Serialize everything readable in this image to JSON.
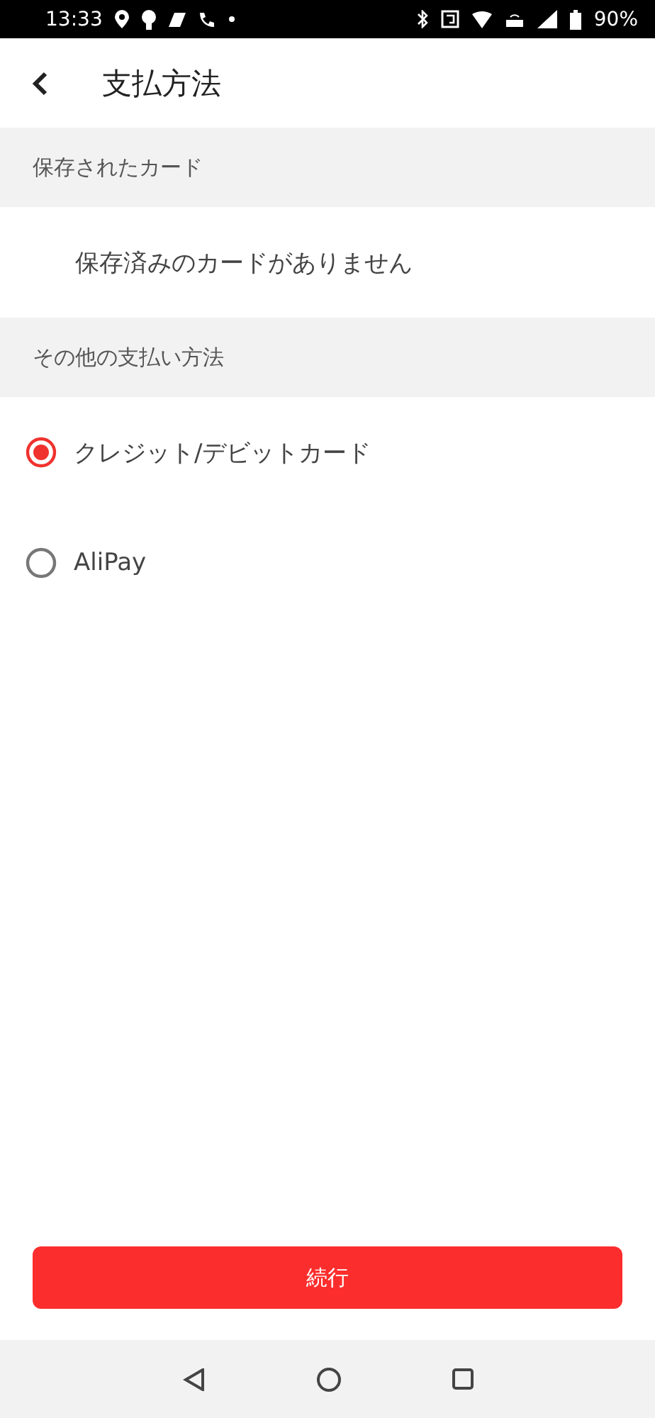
{
  "status_bar": {
    "time": "13:33",
    "battery": "90%"
  },
  "header": {
    "title": "支払方法"
  },
  "saved_cards": {
    "heading": "保存されたカード",
    "empty_text": "保存済みのカードがありません"
  },
  "other_methods": {
    "heading": "その他の支払い方法",
    "options": [
      {
        "label": "クレジット/デビットカード",
        "selected": true
      },
      {
        "label": "AliPay",
        "selected": false
      }
    ]
  },
  "continue_button": "続行"
}
